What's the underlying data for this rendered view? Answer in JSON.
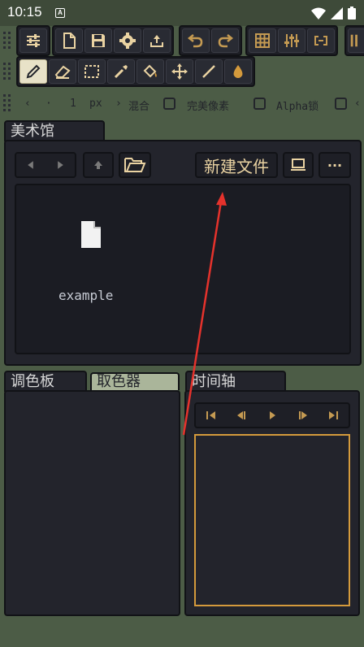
{
  "status_bar": {
    "time": "10:15",
    "badge": "A"
  },
  "toolbar_top": {
    "group1": [
      "settings-sliders-icon"
    ],
    "group2": [
      "new-file-icon",
      "save-icon",
      "gear-icon",
      "export-icon"
    ],
    "group3": [
      "undo-icon",
      "redo-icon"
    ],
    "group4": [
      "grid-icon",
      "levels-icon",
      "loop-icon"
    ]
  },
  "toolbar_tools": [
    "pencil-icon",
    "eraser-icon",
    "select-icon",
    "eyedropper-icon",
    "fill-icon",
    "move-icon",
    "line-icon",
    "shade-icon"
  ],
  "tool_options": {
    "size_value": "1",
    "size_unit": "px",
    "blend_label": "混合",
    "perfect_pixel_label": "完美像素",
    "alpha_lock_label": "Alpha锁"
  },
  "gallery": {
    "tab": "美术馆",
    "new_file_label": "新建文件",
    "more_label": "···",
    "files": [
      {
        "name": "example"
      }
    ]
  },
  "palette_tabs": {
    "palette": "调色板",
    "color_picker": "取色器"
  },
  "timeline": {
    "tab": "时间轴"
  },
  "colors": {
    "accent": "#d49a3c",
    "background": "#4c5c46",
    "panel": "#23242c"
  }
}
